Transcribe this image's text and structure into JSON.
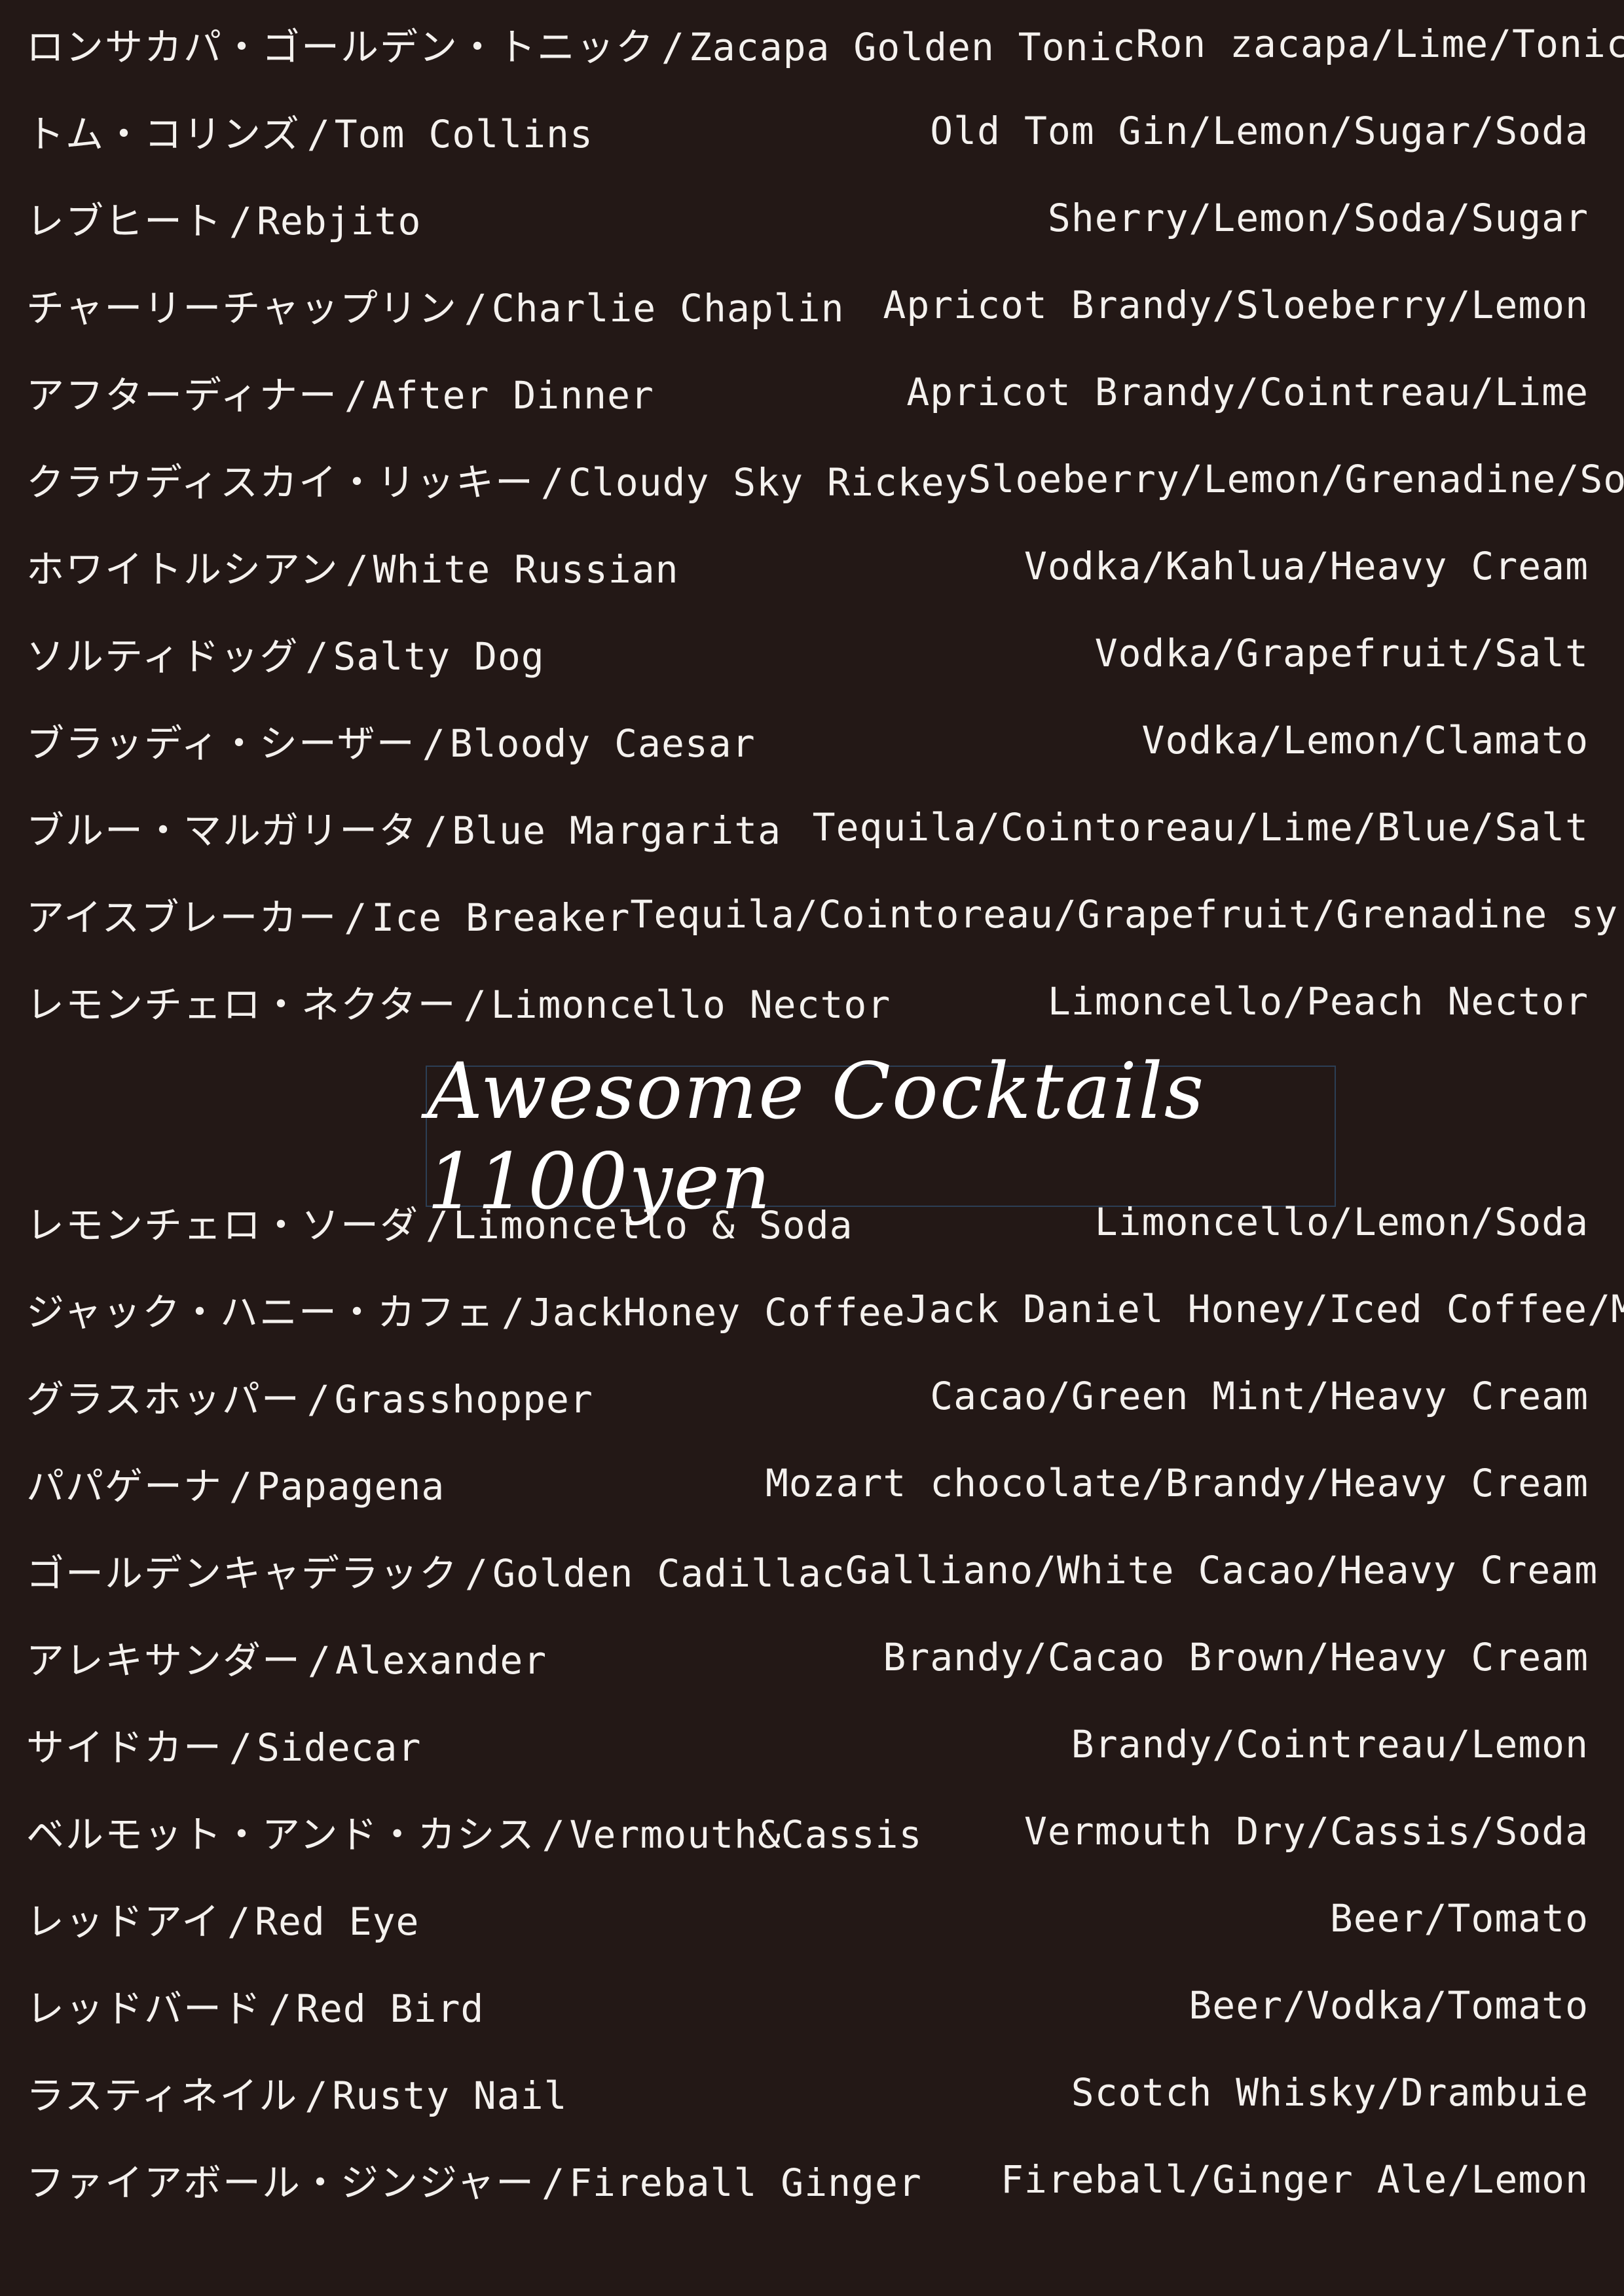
{
  "title": "Awesome Cocktails 1100yen",
  "top_items": [
    {
      "jp": "ロンサカパ・ゴールデン・トニック",
      "en": "Zacapa Golden Tonic",
      "ingredients": "Ron zacapa/Lime/Tonic"
    },
    {
      "jp": "トム・コリンズ",
      "en": "Tom Collins",
      "ingredients": "Old Tom Gin/Lemon/Sugar/Soda"
    },
    {
      "jp": "レブヒート",
      "en": "Rebjito",
      "ingredients": "Sherry/Lemon/Soda/Sugar"
    },
    {
      "jp": "チャーリーチャップリン",
      "en": "Charlie Chaplin",
      "ingredients": "Apricot Brandy/Sloeberry/Lemon"
    },
    {
      "jp": "アフターディナー",
      "en": "After Dinner",
      "ingredients": "Apricot Brandy/Cointreau/Lime"
    },
    {
      "jp": "クラウディスカイ・リッキー",
      "en": "Cloudy Sky Rickey",
      "ingredients": "Sloeberry/Lemon/Grenadine/Soda"
    },
    {
      "jp": "ホワイトルシアン",
      "en": "White Russian",
      "ingredients": "Vodka/Kahlua/Heavy Cream"
    },
    {
      "jp": "ソルティドッグ",
      "en": "Salty Dog",
      "ingredients": "Vodka/Grapefruit/Salt"
    },
    {
      "jp": "ブラッディ・シーザー",
      "en": "Bloody Caesar",
      "ingredients": "Vodka/Lemon/Clamato"
    },
    {
      "jp": "ブルー・マルガリータ",
      "en": "Blue Margarita",
      "ingredients": "Tequila/Cointoreau/Lime/Blue/Salt"
    },
    {
      "jp": "アイスブレーカー",
      "en": "Ice Breaker",
      "ingredients": "Tequila/Cointoreau/Grapefruit/Grenadine syrup"
    },
    {
      "jp": "レモンチェロ・ネクター",
      "en": "Limoncello Nector",
      "ingredients": "Limoncello/Peach Nector"
    }
  ],
  "bottom_items": [
    {
      "jp": "レモンチェロ・ソーダ",
      "en": "Limoncello & Soda",
      "ingredients": "Limoncello/Lemon/Soda"
    },
    {
      "jp": "ジャック・ハニー・カフェ",
      "en": "JackHoney Coffee",
      "ingredients": "Jack Daniel Honey/Iced Coffee/Milk"
    },
    {
      "jp": "グラスホッパー",
      "en": "Grasshopper",
      "ingredients": "Cacao/Green Mint/Heavy Cream"
    },
    {
      "jp": "パパゲーナ",
      "en": "Papagena",
      "ingredients": "Mozart chocolate/Brandy/Heavy Cream"
    },
    {
      "jp": "ゴールデンキャデラック",
      "en": "Golden Cadillac",
      "ingredients": "Galliano/White Cacao/Heavy Cream"
    },
    {
      "jp": "アレキサンダー",
      "en": "Alexander",
      "ingredients": "Brandy/Cacao Brown/Heavy Cream"
    },
    {
      "jp": "サイドカー",
      "en": "Sidecar",
      "ingredients": "Brandy/Cointreau/Lemon"
    },
    {
      "jp": "ベルモット・アンド・カシス",
      "en": "Vermouth&Cassis",
      "ingredients": "Vermouth Dry/Cassis/Soda"
    },
    {
      "jp": "レッドアイ",
      "en": "Red Eye",
      "ingredients": "Beer/Tomato"
    },
    {
      "jp": "レッドバード",
      "en": "Red Bird",
      "ingredients": "Beer/Vodka/Tomato"
    },
    {
      "jp": "ラスティネイル",
      "en": "Rusty Nail",
      "ingredients": "Scotch Whisky/Drambuie"
    },
    {
      "jp": "ファイアボール・ジンジャー",
      "en": "Fireball Ginger",
      "ingredients": "Fireball/Ginger Ale/Lemon"
    }
  ]
}
